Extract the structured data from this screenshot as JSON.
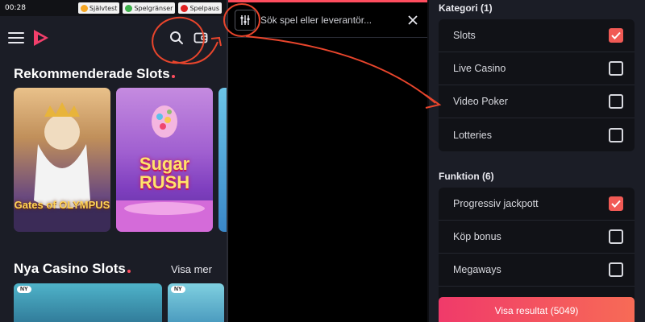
{
  "status": {
    "time": "00:28",
    "pills": [
      {
        "label": "Självtest",
        "icon": "selftest-icon",
        "color": "#f5a623"
      },
      {
        "label": "Spelgränser",
        "icon": "limits-icon",
        "color": "#3cb04a"
      },
      {
        "label": "Spelpaus",
        "icon": "pause-icon",
        "color": "#e02020"
      }
    ]
  },
  "home": {
    "recommended_title": "Rekommenderade Slots",
    "games": [
      {
        "name": "Gates of Olympus",
        "title_art": "Gates of OLYMPUS"
      },
      {
        "name": "Sugar Rush",
        "title_art": "Sugar RUSH"
      }
    ],
    "new_title": "Nya Casino Slots",
    "see_more": "Visa mer",
    "new_badge": "NY"
  },
  "search": {
    "placeholder": "Sök spel eller leverantör..."
  },
  "filters": {
    "categories": {
      "title": "Kategori (1)",
      "options": [
        {
          "label": "Slots",
          "checked": true
        },
        {
          "label": "Live Casino",
          "checked": false
        },
        {
          "label": "Video Poker",
          "checked": false
        },
        {
          "label": "Lotteries",
          "checked": false
        }
      ]
    },
    "features": {
      "title": "Funktion (6)",
      "options": [
        {
          "label": "Progressiv jackpott",
          "checked": true
        },
        {
          "label": "Köp bonus",
          "checked": false
        },
        {
          "label": "Megaways",
          "checked": false
        }
      ]
    },
    "result_button": "Visa resultat (5049)"
  },
  "colors": {
    "accent": "#f15a55",
    "background": "#1b1d26",
    "annotation": "#e8452c"
  }
}
